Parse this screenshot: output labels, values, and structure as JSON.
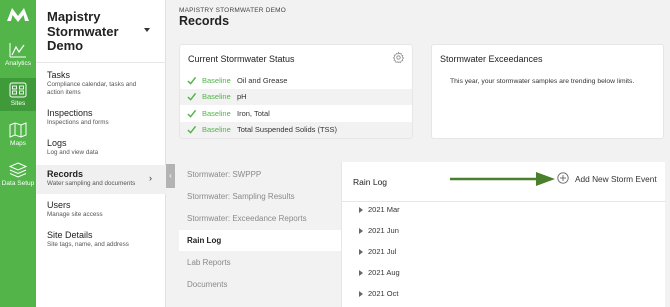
{
  "rail": {
    "items": [
      {
        "label": "Analytics",
        "icon": "analytics-icon"
      },
      {
        "label": "Sites",
        "icon": "sites-icon"
      },
      {
        "label": "Maps",
        "icon": "maps-icon"
      },
      {
        "label": "Data Setup",
        "icon": "database-icon"
      }
    ]
  },
  "nav": {
    "org_name": "Mapistry Stormwater Demo",
    "items": [
      {
        "title": "Tasks",
        "subtitle": "Compliance calendar, tasks and action items"
      },
      {
        "title": "Inspections",
        "subtitle": "Inspections and forms"
      },
      {
        "title": "Logs",
        "subtitle": "Log and view data"
      },
      {
        "title": "Records",
        "subtitle": "Water sampling and documents",
        "chevron": "›"
      },
      {
        "title": "Users",
        "subtitle": "Manage site access"
      },
      {
        "title": "Site Details",
        "subtitle": "Site tags, name, and address"
      }
    ],
    "collapse_glyph": "‹"
  },
  "header": {
    "breadcrumb": "MAPISTRY STORMWATER DEMO",
    "title": "Records"
  },
  "status_card": {
    "title": "Current Stormwater Status",
    "rows": [
      {
        "status": "Baseline",
        "parameter": "Oil and Grease"
      },
      {
        "status": "Baseline",
        "parameter": "pH"
      },
      {
        "status": "Baseline",
        "parameter": "Iron, Total"
      },
      {
        "status": "Baseline",
        "parameter": "Total Suspended Solids (TSS)"
      }
    ]
  },
  "exceedances_card": {
    "title": "Stormwater Exceedances",
    "text": "This year, your stormwater samples are trending below limits."
  },
  "records_list": {
    "items": [
      "Stormwater: SWPPP",
      "Stormwater: Sampling Results",
      "Stormwater: Exceedance Reports",
      "Rain Log",
      "Lab Reports",
      "Documents"
    ]
  },
  "rain_log": {
    "title": "Rain Log",
    "add_label": "Add New Storm Event",
    "months": [
      "2021 Mar",
      "2021 Jun",
      "2021 Jul",
      "2021 Aug",
      "2021 Oct"
    ]
  },
  "colors": {
    "brand_green": "#52b449",
    "arrow_green": "#4a7f2b"
  }
}
